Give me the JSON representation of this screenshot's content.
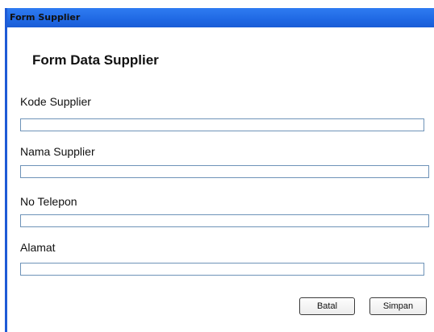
{
  "window": {
    "title": "Form Supplier"
  },
  "form": {
    "heading": "Form Data Supplier",
    "fields": [
      {
        "label": "Kode Supplier",
        "value": ""
      },
      {
        "label": "Nama Supplier",
        "value": ""
      },
      {
        "label": "No Telepon",
        "value": ""
      },
      {
        "label": "Alamat",
        "value": ""
      }
    ]
  },
  "buttons": {
    "cancel_label": "Batal",
    "save_label": "Simpan"
  },
  "colors": {
    "titlebar": "#1f68e3",
    "input_border": "#6e93b8"
  }
}
